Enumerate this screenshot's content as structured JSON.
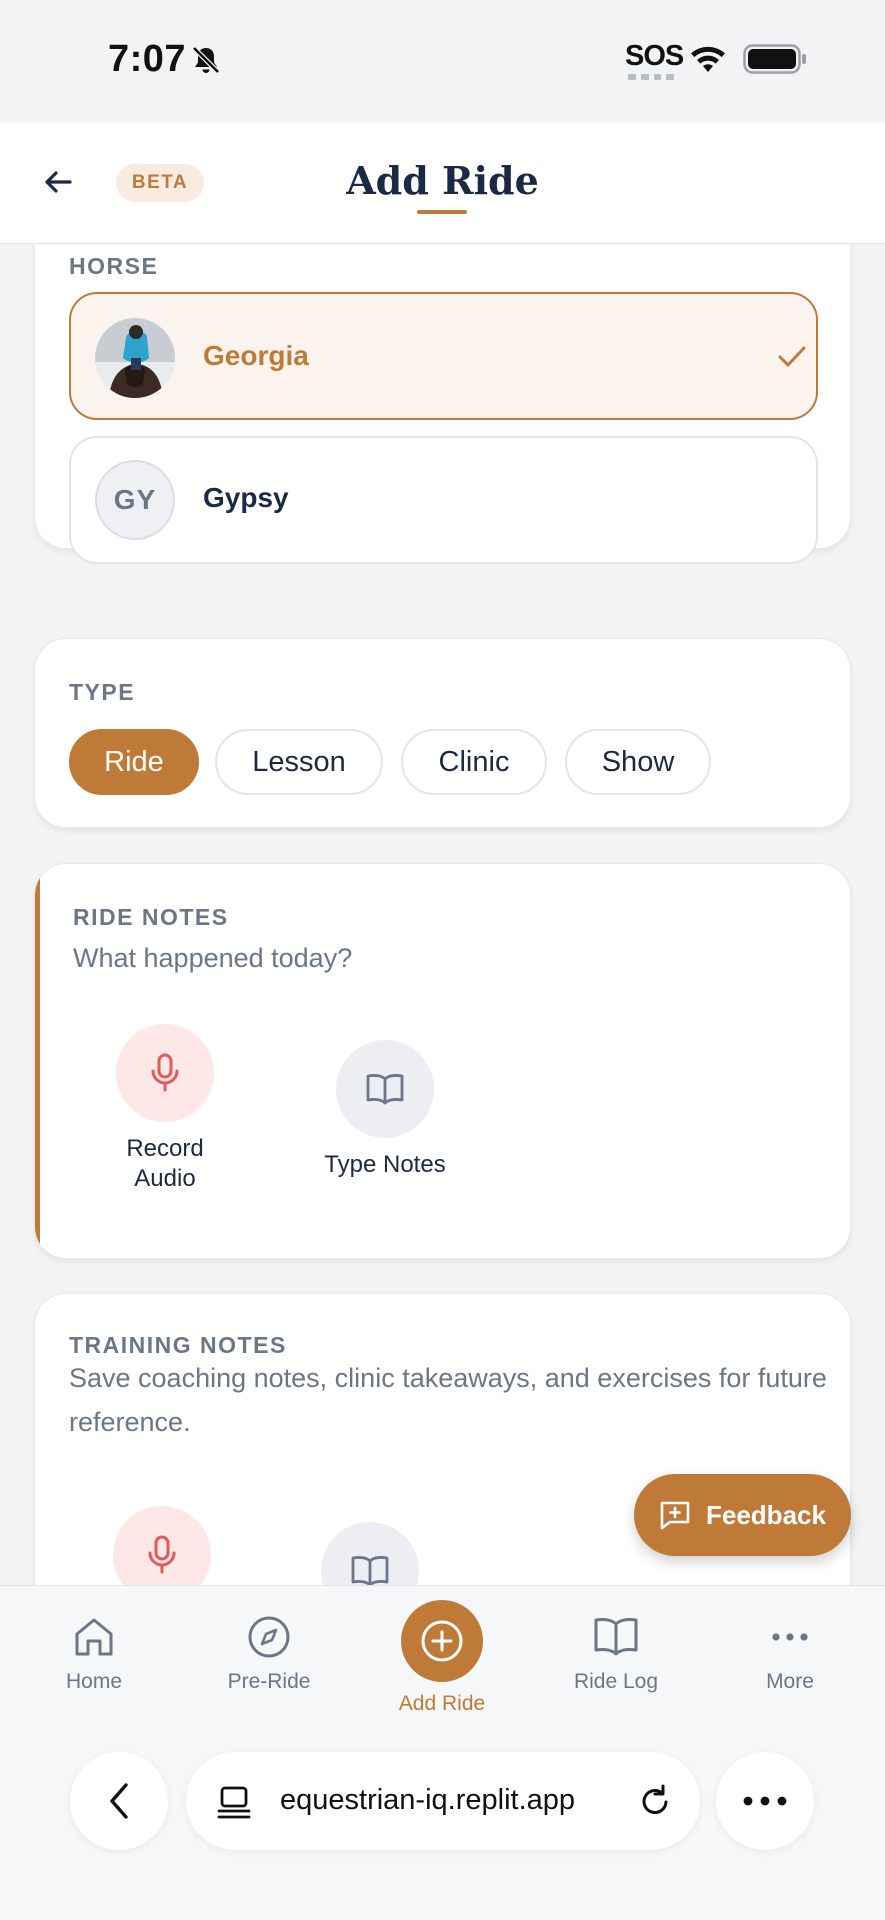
{
  "status_bar": {
    "time": "7:07",
    "sos": "SOS"
  },
  "header": {
    "beta": "BETA",
    "title": "Add Ride"
  },
  "horse": {
    "label": "HORSE",
    "options": [
      {
        "name": "Georgia",
        "selected": true
      },
      {
        "name": "Gypsy",
        "initials": "GY",
        "selected": false
      }
    ]
  },
  "type": {
    "label": "TYPE",
    "options": [
      "Ride",
      "Lesson",
      "Clinic",
      "Show"
    ],
    "selected": "Ride"
  },
  "ride_notes": {
    "label": "RIDE NOTES",
    "description": "What happened today?",
    "record_label": "Record Audio",
    "type_label": "Type Notes"
  },
  "training_notes": {
    "label": "TRAINING NOTES",
    "description": "Save coaching notes, clinic takeaways, and exercises for future reference."
  },
  "feedback": {
    "label": "Feedback"
  },
  "nav": {
    "home": "Home",
    "pre_ride": "Pre-Ride",
    "add_ride": "Add Ride",
    "ride_log": "Ride Log",
    "more": "More"
  },
  "browser": {
    "url": "equestrian-iq.replit.app"
  },
  "colors": {
    "accent": "#c07a38",
    "text": "#1b2a44",
    "muted": "#6b7788",
    "mic": "#e25a5a"
  }
}
